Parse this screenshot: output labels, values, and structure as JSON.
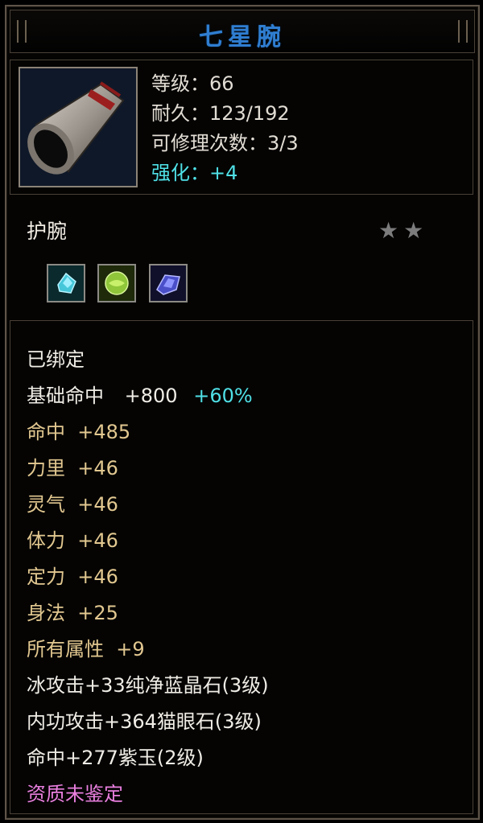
{
  "item": {
    "name": "七星腕",
    "level_text": "等级：66",
    "durability_text": "耐久：123/192",
    "repair_text": "可修理次数：3/3",
    "enhance_label": "强化：",
    "enhance_value": "+4",
    "type": "护腕",
    "stars": "★★",
    "star_count": 2
  },
  "gems": [
    "blue-crystal-gem-icon",
    "green-cat-eye-gem-icon",
    "purple-jade-gem-icon"
  ],
  "attributes": {
    "bound": "已绑定",
    "base_hit_label": "基础命中",
    "base_hit_value": "+800",
    "base_hit_pct": "+60%",
    "hit": "命中  +485",
    "strength": "力里  +46",
    "spirit": "灵气  +46",
    "stamina": "体力  +46",
    "focus": "定力  +46",
    "agility": "身法  +25",
    "all_attr": "所有属性  +9",
    "gem1": "冰攻击+33纯净蓝晶石(3级)",
    "gem2": "内功攻击+364猫眼石(3级)",
    "gem3": "命中+277紫玉(2级)",
    "quality": "资质未鉴定"
  },
  "colors": {
    "title": "#2f7ed1",
    "enhance": "#4fe0e6",
    "bonus": "#e2c890",
    "quality": "#e97fde"
  }
}
